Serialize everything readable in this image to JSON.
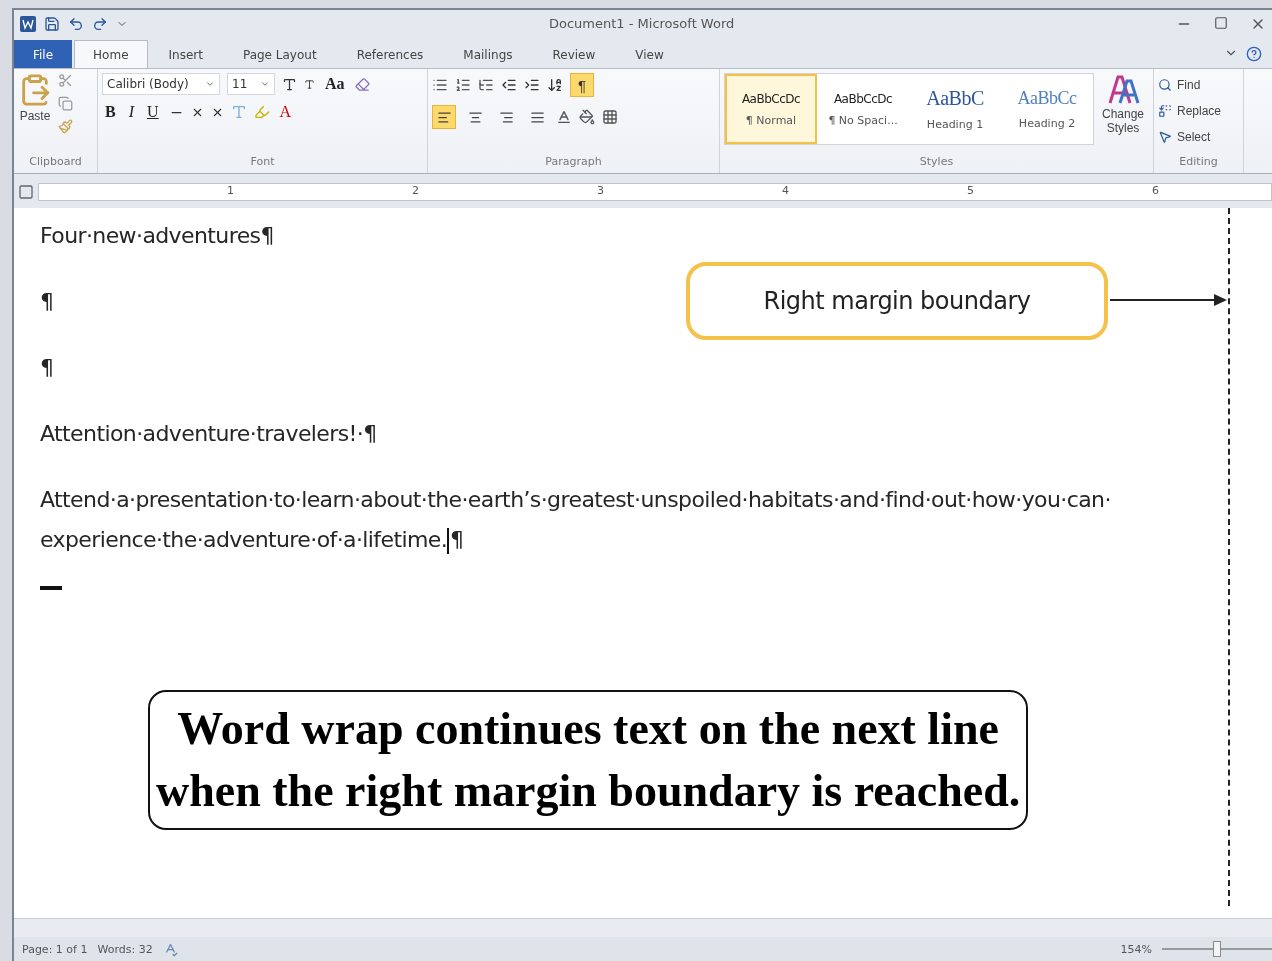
{
  "window": {
    "title": "Document1 - Microsoft Word"
  },
  "tabs": [
    {
      "label": "File",
      "kind": "file",
      "selected": false
    },
    {
      "label": "Home",
      "kind": "tab",
      "selected": true
    },
    {
      "label": "Insert",
      "kind": "tab",
      "selected": false
    },
    {
      "label": "Page Layout",
      "kind": "tab",
      "selected": false
    },
    {
      "label": "References",
      "kind": "tab",
      "selected": false
    },
    {
      "label": "Mailings",
      "kind": "tab",
      "selected": false
    },
    {
      "label": "Review",
      "kind": "tab",
      "selected": false
    },
    {
      "label": "View",
      "kind": "tab",
      "selected": false
    }
  ],
  "clipboard": {
    "paste": "Paste",
    "label": "Clipboard"
  },
  "font": {
    "name": "Calibri (Body)",
    "size": "11",
    "change_case": "Aa",
    "bold": "B",
    "italic": "I",
    "underline": "U",
    "font_color": "A",
    "label": "Font"
  },
  "paragraph": {
    "label": "Paragraph",
    "show_marks": {
      "glyph": "¶",
      "on": true
    },
    "alignments": [
      {
        "kind": "left",
        "selected": true
      },
      {
        "kind": "center",
        "selected": false
      },
      {
        "kind": "right",
        "selected": false
      },
      {
        "kind": "justify",
        "selected": false
      }
    ]
  },
  "styles": {
    "label": "Styles",
    "items": [
      {
        "preview": "AaBbCcDc",
        "name": "¶ Normal",
        "kind": "body",
        "selected": true
      },
      {
        "preview": "AaBbCcDc",
        "name": "¶ No Spaci...",
        "kind": "body",
        "selected": false
      },
      {
        "preview": "AaBbC",
        "name": "Heading 1",
        "kind": "heading1",
        "selected": false
      },
      {
        "preview": "AaBbCc",
        "name": "Heading 2",
        "kind": "heading2",
        "selected": false
      }
    ],
    "change_styles": [
      "Change",
      "Styles"
    ]
  },
  "editing": {
    "label": "Editing",
    "commands": [
      {
        "label": "Find",
        "kind": "find"
      },
      {
        "label": "Replace",
        "kind": "replace"
      },
      {
        "label": "Select",
        "kind": "select"
      }
    ]
  },
  "ruler": {
    "numbers": [
      "1",
      "2",
      "3",
      "4",
      "5",
      "6"
    ]
  },
  "document": {
    "paragraphs": [
      {
        "lines": [
          "Four·new·adventures¶"
        ],
        "cursor": false
      },
      {
        "lines": [
          "¶"
        ],
        "cursor": false
      },
      {
        "lines": [
          "¶"
        ],
        "cursor": false
      },
      {
        "lines": [
          "Attention·adventure·travelers!·¶"
        ],
        "cursor": false
      },
      {
        "lines": [
          "Attend·a·presentation·to·learn·about·the·earth’s·greatest·unspoiled·habitats·and·find·out·how·you·can·",
          "experience·the·adventure·of·a·lifetime.¶"
        ],
        "cursor": true
      }
    ]
  },
  "callouts": {
    "margin_label": "Right margin boundary",
    "caption": [
      "Word wrap continues text on the next line",
      "when the right margin boundary is reached."
    ]
  },
  "status_bar": {
    "page": "Page: 1 of 1",
    "words": "Words: 32",
    "zoom": "154%",
    "zoom_slider": {
      "level": 0.5
    }
  }
}
